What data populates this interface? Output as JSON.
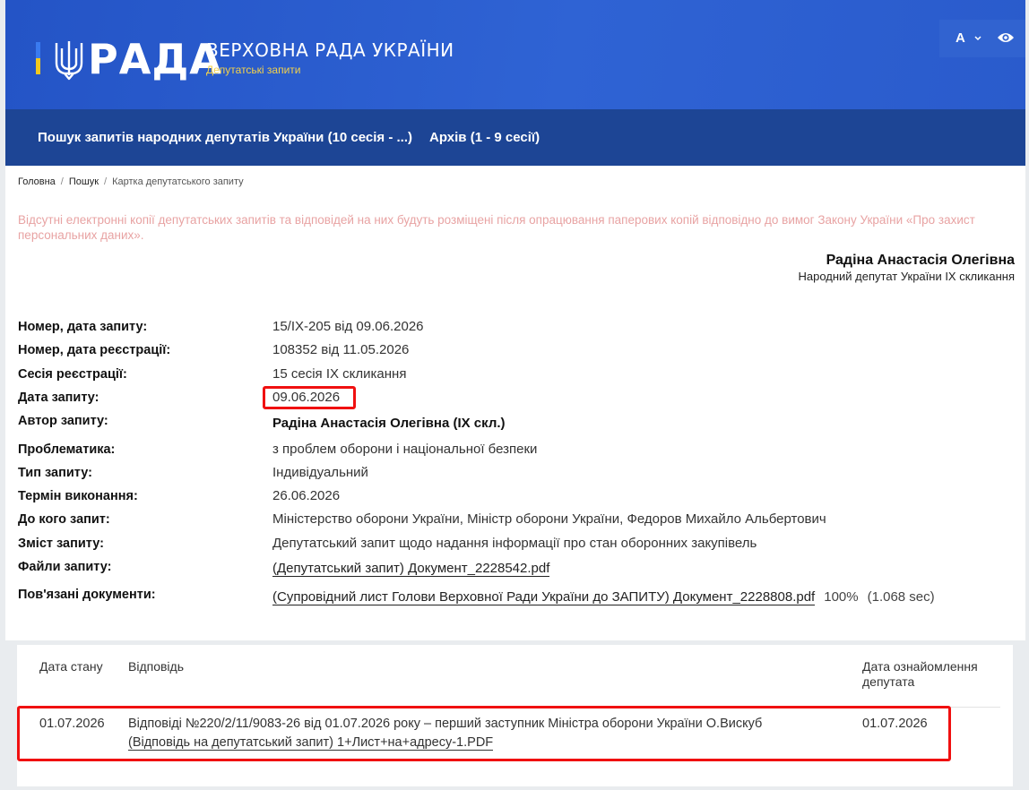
{
  "header": {
    "logo_text": "РАДА",
    "title": "ВЕРХОВНА РАДА УКРАЇНИ",
    "subtitle": "Депутатські запити",
    "font_size_button": "A",
    "colors": {
      "header_bg": "#2a5bcc",
      "nav_bg": "#1d4595",
      "accent_yellow": "#f4d24a",
      "highlight": "#f01010"
    }
  },
  "nav": {
    "items": [
      {
        "label": "Пошук запитів народних депутатів України (10 сесія - ...)"
      },
      {
        "label": "Архів (1 - 9 сесії)"
      }
    ]
  },
  "breadcrumb": {
    "home": "Головна",
    "search": "Пошук",
    "current": "Картка депутатського запиту"
  },
  "notice": "Відсутні електронні копії депутатських запитів та відповідей на них будуть розміщені після опрацювання паперових копій відповідно до вимог Закону України «Про захист персональних даних».",
  "deputy": {
    "name": "Радіна Анастасія Олегівна",
    "role": "Народний депутат України IX скликання"
  },
  "fields": [
    {
      "label": "Номер, дата запиту:",
      "value": "15/IX-205 від 09.06.2026"
    },
    {
      "label": "Номер, дата реєстрації:",
      "value": "108352 від 11.05.2026"
    },
    {
      "label": "Сесія реєстрації:",
      "value": "15 сесія IX скликання"
    },
    {
      "label": "Дата запиту:",
      "value": "09.06.2026"
    },
    {
      "label": "Автор запиту:",
      "value": "Радіна Анастасія Олегівна (IX скл.)"
    },
    {
      "label": "Проблематика:",
      "value": "з проблем оборони і національної безпеки"
    },
    {
      "label": "Тип запиту:",
      "value": "Індивідуальний"
    },
    {
      "label": "Термін виконання:",
      "value": "26.06.2026"
    },
    {
      "label": "До кого запит:",
      "value": "Міністерство оборони України, Міністр оборони України, Федоров Михайло Альбертович"
    },
    {
      "label": "Зміст запиту:",
      "value": "Депутатський запит щодо надання інформації про стан оборонних закупівель"
    },
    {
      "label": "Файли запиту:",
      "value": "(Депутатський запит) Документ_2228542.pdf"
    },
    {
      "label": "Пов'язані документи:",
      "value": "(Супровідний лист Голови Верховної Ради України до ЗАПИТУ) Документ_2228808.pdf",
      "progress": "100%",
      "time": "(1.068 sec)"
    }
  ],
  "responses": {
    "headers": {
      "date": "Дата стану",
      "answer": "Відповідь",
      "ack": "Дата ознайомлення депутата"
    },
    "rows": [
      {
        "date": "01.07.2026",
        "text": "Відповіді №220/2/11/9083-26 від 01.07.2026 року – перший заступник Міністра оборони України О.Вискуб",
        "link": "(Відповідь на депутатський запит) 1+Лист+на+адресу-1.PDF",
        "ack_date": "01.07.2026"
      }
    ]
  }
}
